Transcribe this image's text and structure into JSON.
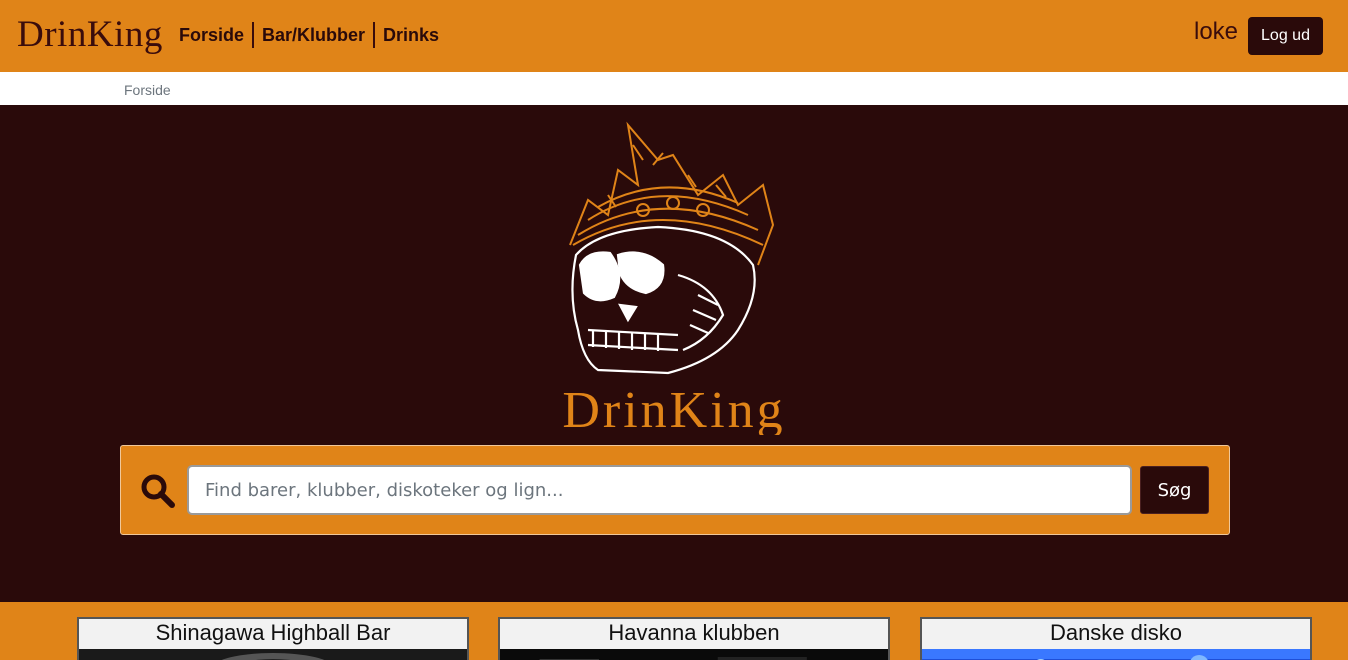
{
  "header": {
    "brand": "DrinKing",
    "nav": [
      "Forside",
      "Bar/Klubber",
      "Drinks"
    ],
    "username": "loke",
    "logout_label": "Log ud"
  },
  "breadcrumb": {
    "current": "Forside"
  },
  "hero": {
    "logo_text": "DrinKing",
    "search_placeholder": "Find barer, klubber, diskoteker og lign...",
    "search_value": "",
    "search_button": "Søg",
    "search_icon": "search-icon"
  },
  "cards": [
    {
      "title": "Shinagawa Highball Bar"
    },
    {
      "title": "Havanna klubben"
    },
    {
      "title": "Danske disko"
    }
  ],
  "colors": {
    "accent": "#e08418",
    "dark": "#2a0a0a",
    "white": "#ffffff"
  }
}
